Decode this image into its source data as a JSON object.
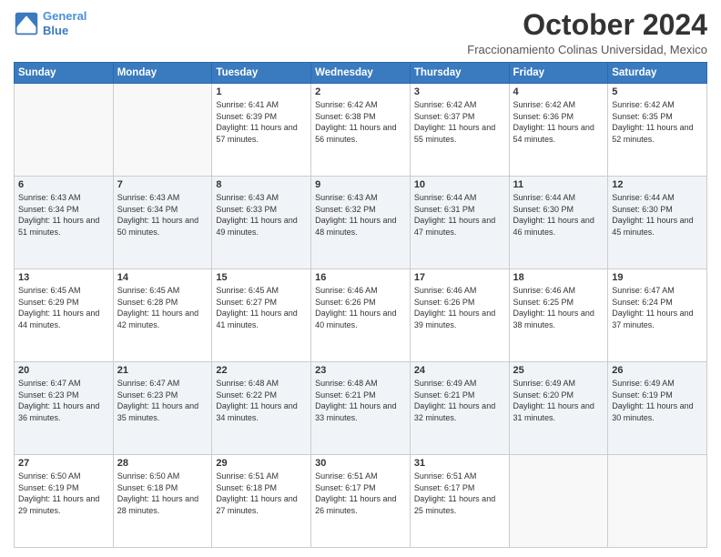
{
  "header": {
    "logo_line1": "General",
    "logo_line2": "Blue",
    "month": "October 2024",
    "location": "Fraccionamiento Colinas Universidad, Mexico"
  },
  "days_of_week": [
    "Sunday",
    "Monday",
    "Tuesday",
    "Wednesday",
    "Thursday",
    "Friday",
    "Saturday"
  ],
  "weeks": [
    [
      {
        "day": "",
        "sunrise": "",
        "sunset": "",
        "daylight": ""
      },
      {
        "day": "",
        "sunrise": "",
        "sunset": "",
        "daylight": ""
      },
      {
        "day": "1",
        "sunrise": "Sunrise: 6:41 AM",
        "sunset": "Sunset: 6:39 PM",
        "daylight": "Daylight: 11 hours and 57 minutes."
      },
      {
        "day": "2",
        "sunrise": "Sunrise: 6:42 AM",
        "sunset": "Sunset: 6:38 PM",
        "daylight": "Daylight: 11 hours and 56 minutes."
      },
      {
        "day": "3",
        "sunrise": "Sunrise: 6:42 AM",
        "sunset": "Sunset: 6:37 PM",
        "daylight": "Daylight: 11 hours and 55 minutes."
      },
      {
        "day": "4",
        "sunrise": "Sunrise: 6:42 AM",
        "sunset": "Sunset: 6:36 PM",
        "daylight": "Daylight: 11 hours and 54 minutes."
      },
      {
        "day": "5",
        "sunrise": "Sunrise: 6:42 AM",
        "sunset": "Sunset: 6:35 PM",
        "daylight": "Daylight: 11 hours and 52 minutes."
      }
    ],
    [
      {
        "day": "6",
        "sunrise": "Sunrise: 6:43 AM",
        "sunset": "Sunset: 6:34 PM",
        "daylight": "Daylight: 11 hours and 51 minutes."
      },
      {
        "day": "7",
        "sunrise": "Sunrise: 6:43 AM",
        "sunset": "Sunset: 6:34 PM",
        "daylight": "Daylight: 11 hours and 50 minutes."
      },
      {
        "day": "8",
        "sunrise": "Sunrise: 6:43 AM",
        "sunset": "Sunset: 6:33 PM",
        "daylight": "Daylight: 11 hours and 49 minutes."
      },
      {
        "day": "9",
        "sunrise": "Sunrise: 6:43 AM",
        "sunset": "Sunset: 6:32 PM",
        "daylight": "Daylight: 11 hours and 48 minutes."
      },
      {
        "day": "10",
        "sunrise": "Sunrise: 6:44 AM",
        "sunset": "Sunset: 6:31 PM",
        "daylight": "Daylight: 11 hours and 47 minutes."
      },
      {
        "day": "11",
        "sunrise": "Sunrise: 6:44 AM",
        "sunset": "Sunset: 6:30 PM",
        "daylight": "Daylight: 11 hours and 46 minutes."
      },
      {
        "day": "12",
        "sunrise": "Sunrise: 6:44 AM",
        "sunset": "Sunset: 6:30 PM",
        "daylight": "Daylight: 11 hours and 45 minutes."
      }
    ],
    [
      {
        "day": "13",
        "sunrise": "Sunrise: 6:45 AM",
        "sunset": "Sunset: 6:29 PM",
        "daylight": "Daylight: 11 hours and 44 minutes."
      },
      {
        "day": "14",
        "sunrise": "Sunrise: 6:45 AM",
        "sunset": "Sunset: 6:28 PM",
        "daylight": "Daylight: 11 hours and 42 minutes."
      },
      {
        "day": "15",
        "sunrise": "Sunrise: 6:45 AM",
        "sunset": "Sunset: 6:27 PM",
        "daylight": "Daylight: 11 hours and 41 minutes."
      },
      {
        "day": "16",
        "sunrise": "Sunrise: 6:46 AM",
        "sunset": "Sunset: 6:26 PM",
        "daylight": "Daylight: 11 hours and 40 minutes."
      },
      {
        "day": "17",
        "sunrise": "Sunrise: 6:46 AM",
        "sunset": "Sunset: 6:26 PM",
        "daylight": "Daylight: 11 hours and 39 minutes."
      },
      {
        "day": "18",
        "sunrise": "Sunrise: 6:46 AM",
        "sunset": "Sunset: 6:25 PM",
        "daylight": "Daylight: 11 hours and 38 minutes."
      },
      {
        "day": "19",
        "sunrise": "Sunrise: 6:47 AM",
        "sunset": "Sunset: 6:24 PM",
        "daylight": "Daylight: 11 hours and 37 minutes."
      }
    ],
    [
      {
        "day": "20",
        "sunrise": "Sunrise: 6:47 AM",
        "sunset": "Sunset: 6:23 PM",
        "daylight": "Daylight: 11 hours and 36 minutes."
      },
      {
        "day": "21",
        "sunrise": "Sunrise: 6:47 AM",
        "sunset": "Sunset: 6:23 PM",
        "daylight": "Daylight: 11 hours and 35 minutes."
      },
      {
        "day": "22",
        "sunrise": "Sunrise: 6:48 AM",
        "sunset": "Sunset: 6:22 PM",
        "daylight": "Daylight: 11 hours and 34 minutes."
      },
      {
        "day": "23",
        "sunrise": "Sunrise: 6:48 AM",
        "sunset": "Sunset: 6:21 PM",
        "daylight": "Daylight: 11 hours and 33 minutes."
      },
      {
        "day": "24",
        "sunrise": "Sunrise: 6:49 AM",
        "sunset": "Sunset: 6:21 PM",
        "daylight": "Daylight: 11 hours and 32 minutes."
      },
      {
        "day": "25",
        "sunrise": "Sunrise: 6:49 AM",
        "sunset": "Sunset: 6:20 PM",
        "daylight": "Daylight: 11 hours and 31 minutes."
      },
      {
        "day": "26",
        "sunrise": "Sunrise: 6:49 AM",
        "sunset": "Sunset: 6:19 PM",
        "daylight": "Daylight: 11 hours and 30 minutes."
      }
    ],
    [
      {
        "day": "27",
        "sunrise": "Sunrise: 6:50 AM",
        "sunset": "Sunset: 6:19 PM",
        "daylight": "Daylight: 11 hours and 29 minutes."
      },
      {
        "day": "28",
        "sunrise": "Sunrise: 6:50 AM",
        "sunset": "Sunset: 6:18 PM",
        "daylight": "Daylight: 11 hours and 28 minutes."
      },
      {
        "day": "29",
        "sunrise": "Sunrise: 6:51 AM",
        "sunset": "Sunset: 6:18 PM",
        "daylight": "Daylight: 11 hours and 27 minutes."
      },
      {
        "day": "30",
        "sunrise": "Sunrise: 6:51 AM",
        "sunset": "Sunset: 6:17 PM",
        "daylight": "Daylight: 11 hours and 26 minutes."
      },
      {
        "day": "31",
        "sunrise": "Sunrise: 6:51 AM",
        "sunset": "Sunset: 6:17 PM",
        "daylight": "Daylight: 11 hours and 25 minutes."
      },
      {
        "day": "",
        "sunrise": "",
        "sunset": "",
        "daylight": ""
      },
      {
        "day": "",
        "sunrise": "",
        "sunset": "",
        "daylight": ""
      }
    ]
  ]
}
